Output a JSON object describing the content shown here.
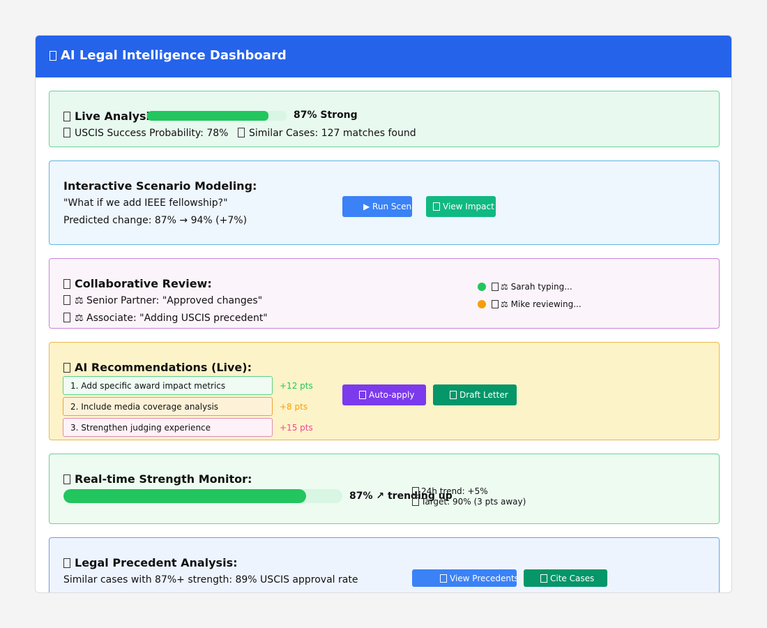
{
  "header": {
    "title": "AI Legal Intelligence Dashboard",
    "icon": "scales-icon"
  },
  "live": {
    "title": "Live Analysis",
    "strength": 87,
    "strength_label": "87% Strong",
    "uscis": "USCIS Success Probability: 78%",
    "similar": "Similar Cases: 127 matches found"
  },
  "scenario": {
    "title": "Interactive Scenario Modeling:",
    "question": "\"What if we add IEEE fellowship?\"",
    "change": "Predicted change: 87% → 94% (+7%)",
    "run_label": "▶ Run Scenario",
    "view_label": "View Impact"
  },
  "collab": {
    "title": "Collaborative Review:",
    "comment1": "⚖ Senior Partner: \"Approved changes\"",
    "comment2": "⚖ Associate: \"Adding USCIS precedent\"",
    "presence": [
      {
        "text": "⚖ Sarah typing...",
        "color": "#22c55e"
      },
      {
        "text": "⚖ Mike reviewing...",
        "color": "#f59e0b"
      }
    ]
  },
  "ai": {
    "title": "AI Recommendations (Live):",
    "items": [
      {
        "text": "1. Add specific award impact metrics",
        "pts": "+12 pts",
        "color": "#22c55e"
      },
      {
        "text": "2. Include media coverage analysis",
        "pts": "+8 pts",
        "color": "#f59e0b"
      },
      {
        "text": "3. Strengthen judging experience",
        "pts": "+15 pts",
        "color": "#ec4899"
      }
    ],
    "autoapply_label": "Auto-apply",
    "draft_label": "Draft Letter"
  },
  "monitor": {
    "title": "Real-time Strength Monitor:",
    "strength": 87,
    "label": "87% ↗ trending up",
    "trend": "24h trend: +5%",
    "target": "Target: 90% (3 pts away)"
  },
  "precedent": {
    "title": "Legal Precedent Analysis:",
    "text": "Similar cases with 87%+ strength: 89% USCIS approval rate",
    "view_label": "View Precedents",
    "cite_label": "Cite Cases"
  },
  "colors": {
    "header": "#2563eb",
    "green": "#22c55e",
    "blue_button": "#3b82f6",
    "teal_button": "#10b981",
    "purple_button": "#7c3aed",
    "dark_green_button": "#059669"
  }
}
